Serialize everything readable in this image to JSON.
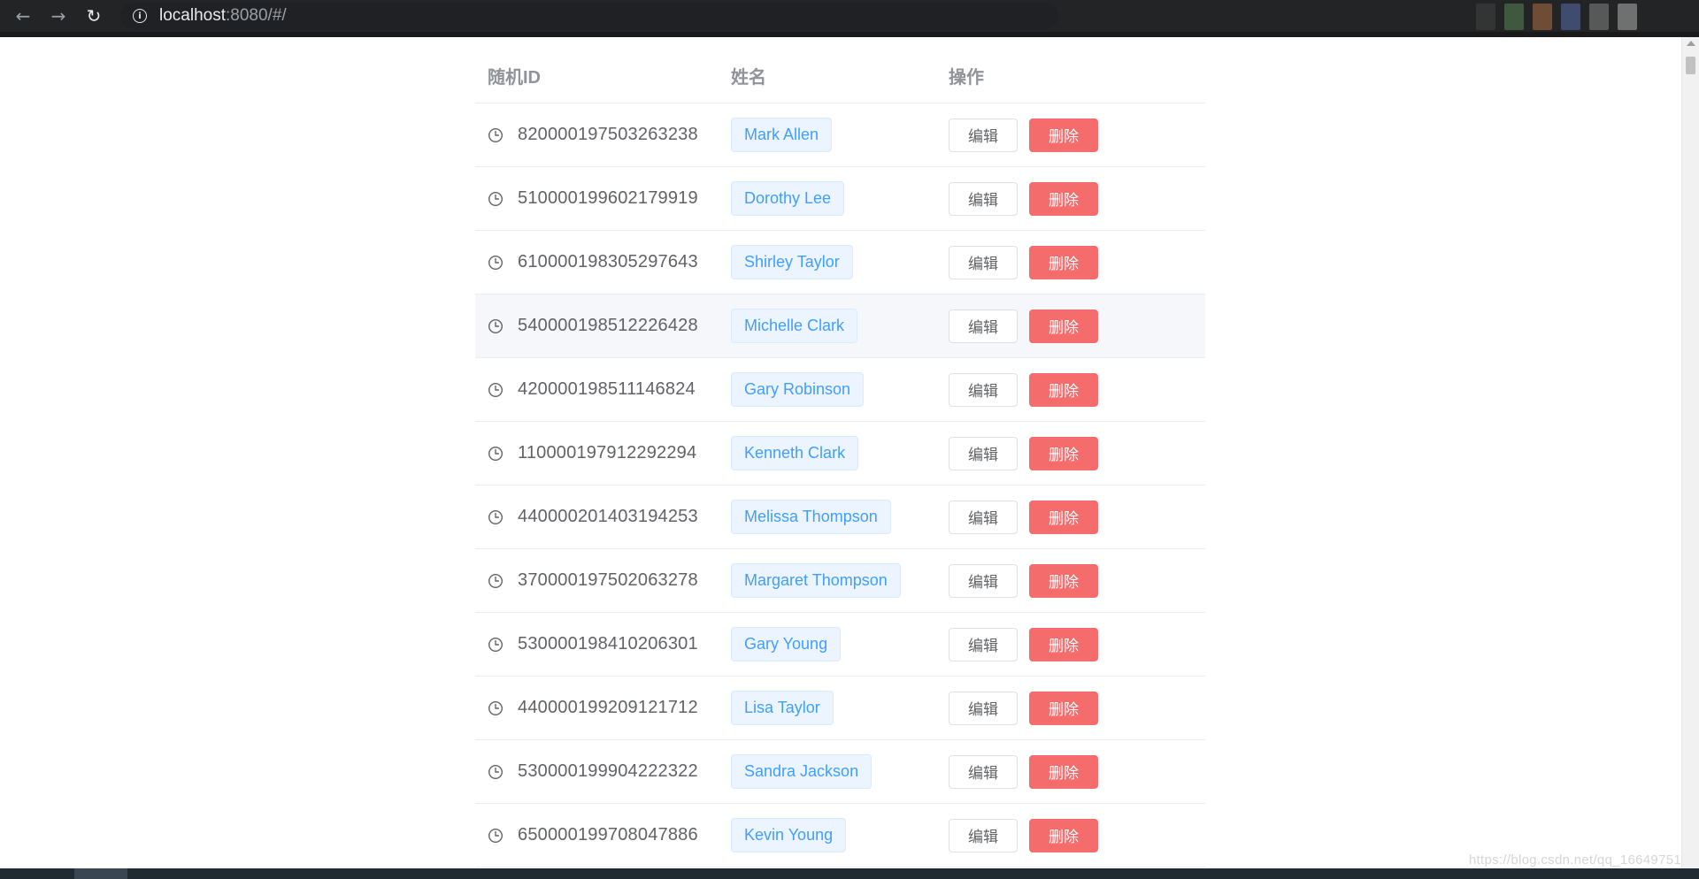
{
  "browser": {
    "url_host": "localhost",
    "url_rest": ":8080/#/",
    "back_glyph": "←",
    "forward_glyph": "→",
    "reload_glyph": "↻",
    "info_glyph": "i",
    "extension_colors": [
      "#3a3a3a",
      "#4a6a4a",
      "#8a5a3a",
      "#4a5a8a",
      "#6a6a6a",
      "#8a8a8a"
    ]
  },
  "table": {
    "headers": {
      "id": "随机ID",
      "name": "姓名",
      "ops": "操作"
    },
    "edit_label": "编辑",
    "delete_label": "删除",
    "hover_row_index": 3,
    "rows": [
      {
        "id": "820000197503263238",
        "name": "Mark Allen"
      },
      {
        "id": "510000199602179919",
        "name": "Dorothy Lee"
      },
      {
        "id": "610000198305297643",
        "name": "Shirley Taylor"
      },
      {
        "id": "540000198512226428",
        "name": "Michelle Clark"
      },
      {
        "id": "420000198511146824",
        "name": "Gary Robinson"
      },
      {
        "id": "110000197912292294",
        "name": "Kenneth Clark"
      },
      {
        "id": "440000201403194253",
        "name": "Melissa Thompson"
      },
      {
        "id": "370000197502063278",
        "name": "Margaret Thompson"
      },
      {
        "id": "530000198410206301",
        "name": "Gary Young"
      },
      {
        "id": "440000199209121712",
        "name": "Lisa Taylor"
      },
      {
        "id": "530000199904222322",
        "name": "Sandra Jackson"
      },
      {
        "id": "650000199708047886",
        "name": "Kevin Young"
      }
    ]
  },
  "colors": {
    "primary": "#409eff",
    "danger": "#f56c6c",
    "text": "#606266",
    "header_text": "#909399",
    "border": "#ebeef5"
  },
  "watermark": "https://blog.csdn.net/qq_16649751"
}
